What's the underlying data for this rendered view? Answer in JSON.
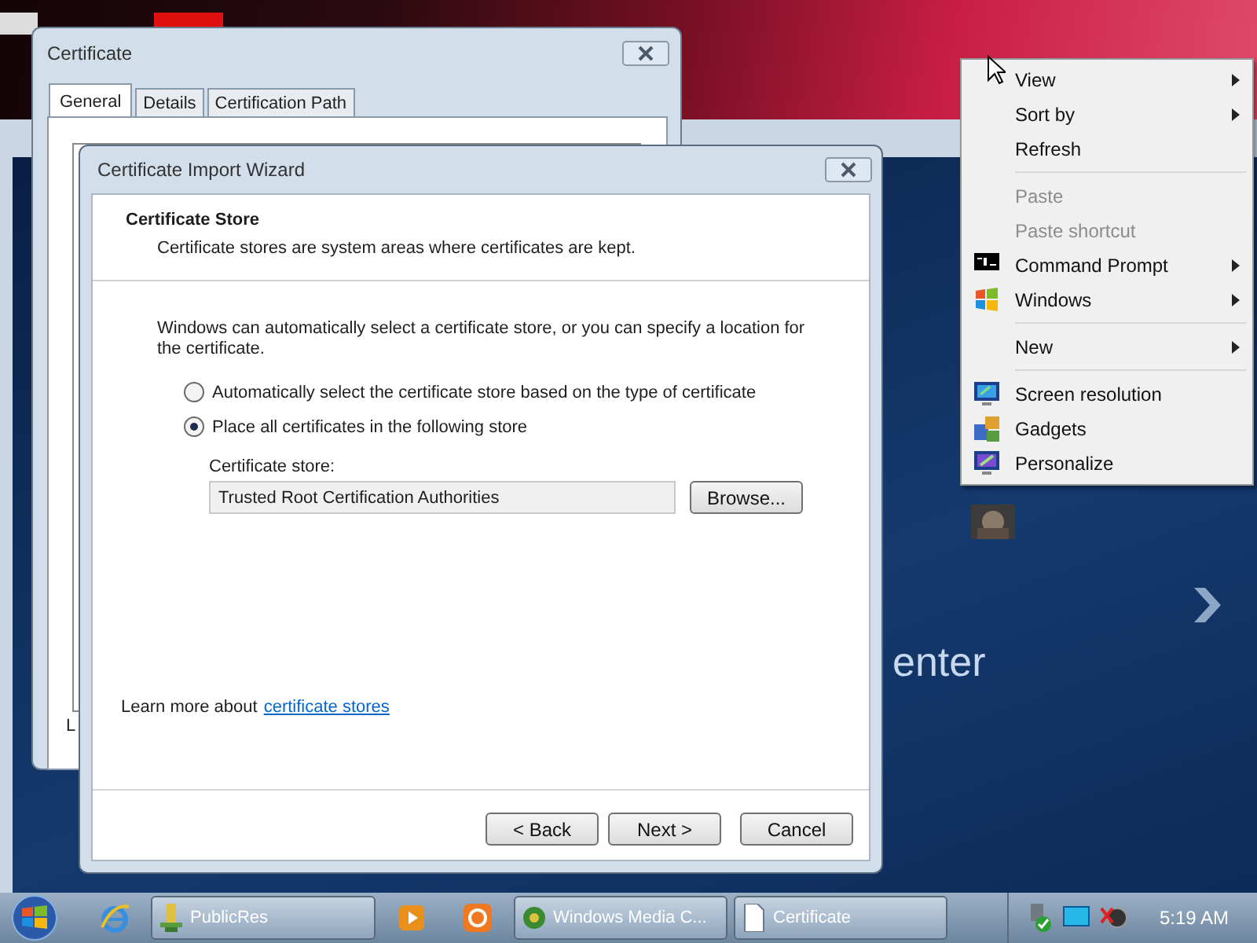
{
  "media_center": {
    "large_text": "enter"
  },
  "certificate_window": {
    "title": "Certificate",
    "tabs": [
      {
        "label": "General",
        "selected": true
      },
      {
        "label": "Details",
        "selected": false
      },
      {
        "label": "Certification Path",
        "selected": false
      }
    ],
    "footer_text": "L"
  },
  "wizard": {
    "title": "Certificate Import Wizard",
    "header_title": "Certificate Store",
    "header_subtitle": "Certificate stores are system areas where certificates are kept.",
    "intro": "Windows can automatically select a certificate store, or you can specify a location for the certificate.",
    "options": [
      {
        "label": "Automatically select the certificate store based on the type of certificate",
        "selected": false
      },
      {
        "label": "Place all certificates in the following store",
        "selected": true
      }
    ],
    "store_label": "Certificate store:",
    "store_value": "Trusted Root Certification Authorities",
    "browse_button": "Browse...",
    "learn_more_text": "Learn more about",
    "learn_more_link": "certificate stores",
    "buttons": [
      {
        "label": "< Back"
      },
      {
        "label": "Next >"
      },
      {
        "label": "Cancel"
      }
    ]
  },
  "context_menu": {
    "groups": [
      [
        {
          "label": "View",
          "disabled": false,
          "submenu": true
        },
        {
          "label": "Sort by",
          "disabled": false,
          "submenu": true
        },
        {
          "label": "Refresh",
          "disabled": false,
          "submenu": false
        }
      ],
      [
        {
          "label": "Paste",
          "disabled": true,
          "submenu": false
        },
        {
          "label": "Paste shortcut",
          "disabled": true,
          "submenu": false
        },
        {
          "label": "Command Prompt",
          "disabled": false,
          "submenu": true
        },
        {
          "label": "Windows",
          "disabled": false,
          "submenu": true
        }
      ],
      [
        {
          "label": "New",
          "disabled": false,
          "submenu": true
        }
      ],
      [
        {
          "label": "Screen resolution",
          "disabled": false,
          "submenu": false
        },
        {
          "label": "Gadgets",
          "disabled": false,
          "submenu": false
        },
        {
          "label": "Personalize",
          "disabled": false,
          "submenu": false
        }
      ]
    ]
  },
  "taskbar": {
    "buttons": [
      {
        "label": "PublicRes"
      },
      {
        "label": "Windows Media C..."
      },
      {
        "label": "Certificate"
      }
    ],
    "clock": "5:19 AM"
  }
}
